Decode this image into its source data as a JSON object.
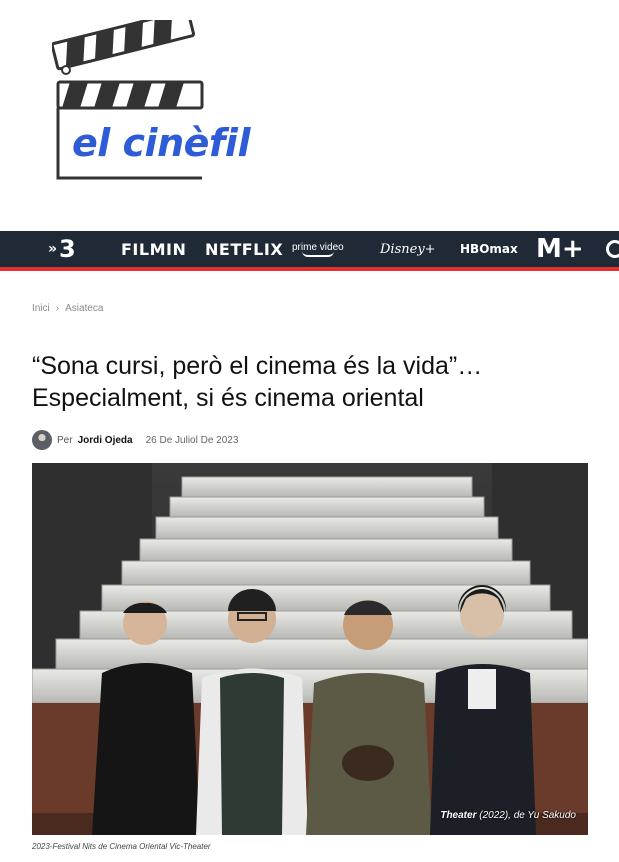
{
  "site": {
    "logo_text": "el cinèfil"
  },
  "nav": {
    "items": [
      {
        "label": "3",
        "icon": "tv3-logo"
      },
      {
        "label": "FILMIN"
      },
      {
        "label": "NETFLIX"
      },
      {
        "label": "prime video"
      },
      {
        "label": "Disney+"
      },
      {
        "label": "HBOmax"
      },
      {
        "label": "M+"
      }
    ],
    "accent_color": "#e0312e",
    "background_color": "#202a36"
  },
  "breadcrumb": {
    "home": "Inici",
    "separator": "›",
    "section": "Asiateca"
  },
  "article": {
    "title_line1": "“Sona cursi, però el cinema és la vida”…",
    "title_line2": "Especialment, si és cinema oriental",
    "by_label": "Per",
    "author": "Jordi Ojeda",
    "date": "26 De Juliol De 2023",
    "photo_credit_title": "Theater",
    "photo_credit_rest": " (2022), de Yu Sakudo",
    "caption": "2023-Festival Nits de Cinema Oriental Vic-Theater"
  }
}
